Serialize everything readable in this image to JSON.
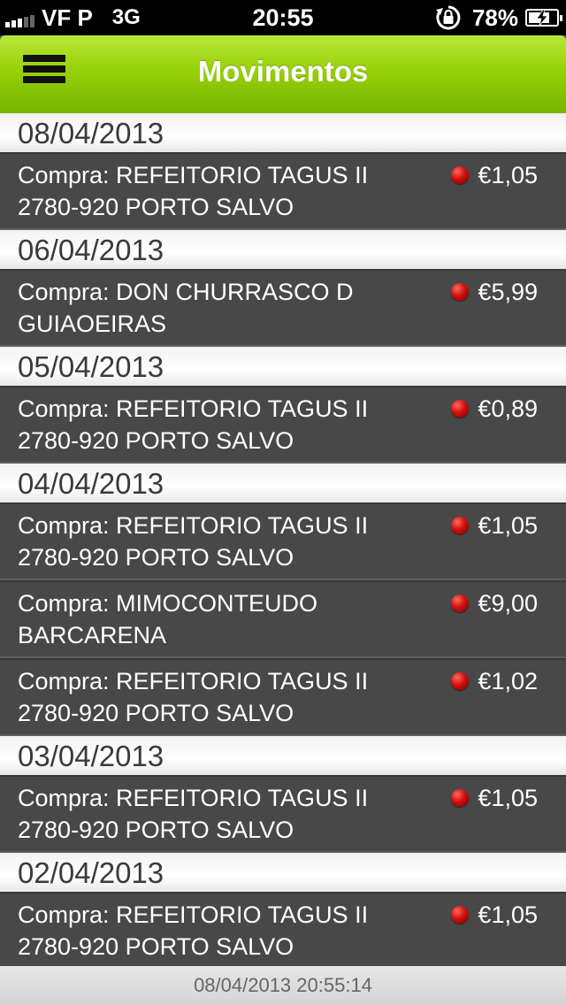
{
  "status_bar": {
    "carrier": "VF P",
    "network": "3G",
    "time": "20:55",
    "battery_percent_label": "78%",
    "battery_level": 0.78,
    "signal_bars_on": 3,
    "signal_bars_total": 5
  },
  "nav": {
    "title": "Movimentos"
  },
  "groups": [
    {
      "date": "08/04/2013",
      "transactions": [
        {
          "line1": "Compra: REFEITORIO TAGUS II",
          "line2": "2780-920 PORTO SALVO",
          "amount": "€1,05"
        }
      ]
    },
    {
      "date": "06/04/2013",
      "transactions": [
        {
          "line1": "Compra: DON CHURRASCO D",
          "line2": "GUIAOEIRAS",
          "amount": "€5,99"
        }
      ]
    },
    {
      "date": "05/04/2013",
      "transactions": [
        {
          "line1": "Compra: REFEITORIO TAGUS II",
          "line2": "2780-920 PORTO SALVO",
          "amount": "€0,89"
        }
      ]
    },
    {
      "date": "04/04/2013",
      "transactions": [
        {
          "line1": "Compra: REFEITORIO TAGUS II",
          "line2": "2780-920 PORTO SALVO",
          "amount": "€1,05"
        },
        {
          "line1": "Compra: MIMOCONTEUDO",
          "line2": "BARCARENA",
          "amount": "€9,00"
        },
        {
          "line1": "Compra: REFEITORIO TAGUS II",
          "line2": "2780-920 PORTO SALVO",
          "amount": "€1,02"
        }
      ]
    },
    {
      "date": "03/04/2013",
      "transactions": [
        {
          "line1": "Compra: REFEITORIO TAGUS II",
          "line2": "2780-920 PORTO SALVO",
          "amount": "€1,05"
        }
      ]
    },
    {
      "date": "02/04/2013",
      "transactions": [
        {
          "line1": "Compra: REFEITORIO TAGUS II",
          "line2": "2780-920 PORTO SALVO",
          "amount": "€1,05"
        }
      ]
    }
  ],
  "footer": {
    "timestamp": "08/04/2013 20:55:14"
  },
  "icons": {
    "menu": "hamburger-menu-icon",
    "status_dot": "red-dot-icon",
    "rotation_lock": "rotation-lock-icon",
    "battery": "battery-charging-icon"
  },
  "colors": {
    "nav_green": "#8dc800",
    "row_background": "#484848",
    "date_header_background": "#ffffff",
    "status_dot_red": "#d01010",
    "footer_background": "#dcdcdc"
  }
}
